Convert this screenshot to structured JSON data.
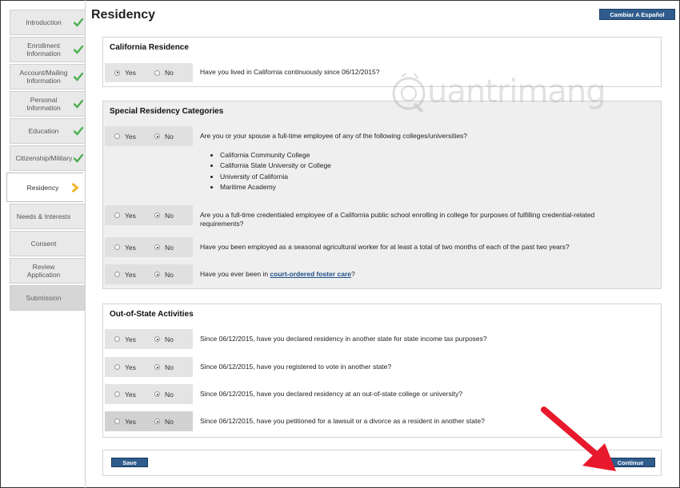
{
  "colors": {
    "accent": "#2f5c8c",
    "check": "#4caf50",
    "chevron": "#f0b429",
    "arrow": "#e8192c"
  },
  "sidebar": {
    "items": [
      {
        "label": "Introduction",
        "status": "complete"
      },
      {
        "label": "Enrollment Information",
        "status": "complete"
      },
      {
        "label": "Account/Mailing Information",
        "status": "complete"
      },
      {
        "label": "Personal Information",
        "status": "complete"
      },
      {
        "label": "Education",
        "status": "complete"
      },
      {
        "label": "Citizenship/Military",
        "status": "complete"
      },
      {
        "label": "Residency",
        "status": "current"
      },
      {
        "label": "Needs & Interests",
        "status": "pending"
      },
      {
        "label": "Consent",
        "status": "pending"
      },
      {
        "label": "Review Application",
        "status": "pending"
      },
      {
        "label": "Submission",
        "status": "disabled"
      }
    ]
  },
  "header": {
    "title": "Residency",
    "language_button": "Cambiar A Español"
  },
  "california_residence": {
    "title": "California Residence",
    "yes_label": "Yes",
    "no_label": "No",
    "question": "Have you lived in California continuously since 06/12/2015?",
    "selected": "Yes"
  },
  "special_residency": {
    "title": "Special Residency Categories",
    "q1": {
      "question": "Are you or your spouse a full-time employee of any of the following colleges/universities?",
      "selected": "No",
      "list": [
        "California Community College",
        "California State University or College",
        "University of California",
        "Maritime Academy"
      ]
    },
    "q2": {
      "question": "Are you a full-time credentialed employee of a California public school enrolling in college for purposes of fulfilling credential-related requirements?",
      "selected": "No"
    },
    "q3": {
      "question": "Have you been employed as a seasonal agricultural worker for at least a total of two months of each of the past two years?",
      "selected": "No"
    },
    "q4": {
      "question_prefix": "Have you ever been in ",
      "link": "court-ordered foster care",
      "question_suffix": "?",
      "selected": "No"
    }
  },
  "out_of_state": {
    "title": "Out-of-State Activities",
    "questions": [
      {
        "question": "Since 06/12/2015, have you declared residency in another state for state income tax purposes?",
        "selected": "No"
      },
      {
        "question": "Since 06/12/2015, have you registered to vote in another state?",
        "selected": "No"
      },
      {
        "question": "Since 06/12/2015, have you declared residency at an out-of-state college or university?",
        "selected": "No"
      },
      {
        "question": "Since 06/12/2015, have you petitioned for a lawsuit or a divorce as a resident in another state?",
        "selected": "No"
      }
    ]
  },
  "actions": {
    "save": "Save",
    "continue": "Continue"
  },
  "watermark": {
    "text": "uantrimang"
  }
}
